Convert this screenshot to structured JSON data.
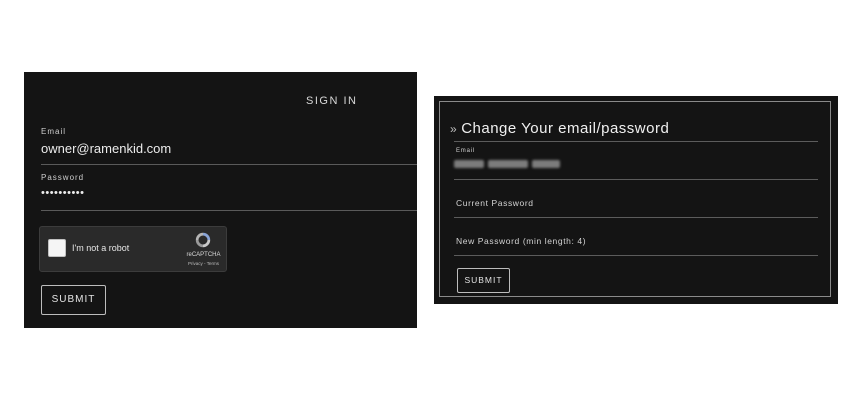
{
  "signin": {
    "title": "SIGN IN",
    "email_label": "Email",
    "email_value": "owner@ramenkid.com",
    "password_label": "Password",
    "password_value": "••••••••••",
    "recaptcha": {
      "label": "I'm not a robot",
      "brand": "reCAPTCHA",
      "links": "Privacy - Terms",
      "checked": false
    },
    "submit_label": "SUBMIT"
  },
  "change": {
    "chevron": "»",
    "heading": "Change Your email/password",
    "email_label": "Email",
    "current_password_label": "Current Password",
    "new_password_label": "New Password (min length: 4)",
    "submit_label": "SUBMIT"
  },
  "colors": {
    "panel_bg": "#141414",
    "page_bg": "#ffffff",
    "text": "#e8e8e8",
    "divider": "#5a5a5a"
  },
  "icons": {
    "recaptcha": "recaptcha-logo-icon",
    "heading": "double-chevron-right-icon"
  }
}
